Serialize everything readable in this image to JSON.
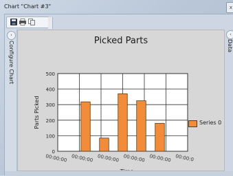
{
  "window": {
    "title": "Chart \"Chart #3\"",
    "close_glyph": "x"
  },
  "toolbar": {
    "save_icon": "save-icon",
    "print_icon": "print-icon",
    "copy_icon": "copy-icon"
  },
  "left_rail": {
    "expand_glyph": "›",
    "label": "Configure Chart"
  },
  "right_rail": {
    "collapse_glyph": "‹",
    "label": "Data"
  },
  "chart_data": {
    "type": "bar",
    "title": "Picked Parts",
    "xlabel": "Time",
    "ylabel": "Parts Picked",
    "ylim": [
      0,
      500
    ],
    "yticks": [
      "0",
      "100",
      "200",
      "300",
      "400",
      "500"
    ],
    "xticks": [
      "00:00:00",
      "00:00:00",
      "00:00:00",
      "00:00:00",
      "00:00:00",
      "00:00:0"
    ],
    "series": [
      {
        "name": "Series 0",
        "values": [
          318,
          85,
          370,
          325,
          180
        ]
      }
    ],
    "colors": {
      "bar": "#f28c38",
      "bar_border": "#5a3a1a"
    },
    "grid": true,
    "legend_position": "right"
  }
}
